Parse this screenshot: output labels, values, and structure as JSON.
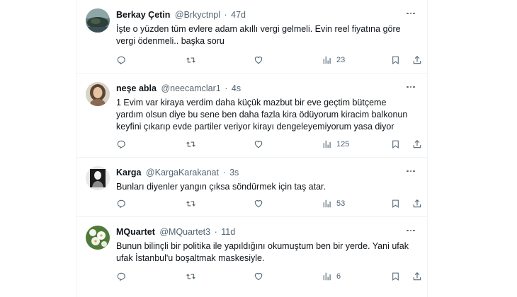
{
  "tweets": [
    {
      "display_name": "Berkay Çetin",
      "handle": "@Brkyctnpl",
      "separator": "·",
      "time": "47d",
      "lines": [
        "İşte o yüzden tüm evlere adam akıllı vergi gelmeli. Evin reel fiyatına göre",
        "vergi ödenmeli.. başka soru"
      ],
      "views": "23",
      "avatar_icon": "landscape-avatar-icon"
    },
    {
      "display_name": "neşe abla",
      "handle": "@neecamclar1",
      "separator": "·",
      "time": "4s",
      "lines": [
        "1 Evim var kiraya verdim daha küçük mazbut bir eve geçtim bütçeme",
        "yardım olsun diye bu sene ben daha fazla kira ödüyorum  kiracim balkonun",
        "keyfini çıkarıp evde partiler veriyor  kirayı dengeleyemiyorum yasa diyor"
      ],
      "views": "125",
      "avatar_icon": "woman-portrait-avatar-icon"
    },
    {
      "display_name": "Karga",
      "handle": "@KargaKarakanat",
      "separator": "·",
      "time": "3s",
      "lines": [
        "Bunları diyenler yangın çıksa söndürmek için taş atar."
      ],
      "views": "53",
      "avatar_icon": "monochrome-figure-avatar-icon"
    },
    {
      "display_name": "MQuartet",
      "handle": "@MQuartet3",
      "separator": "·",
      "time": "11d",
      "lines": [
        "Bunun bilinçli bir politika ile yapıldığını okumuştum ben bir yerde. Yani ufak",
        "ufak İstanbul'u boşaltmak maskesiyle."
      ],
      "views": "6",
      "avatar_icon": "flower-avatar-icon"
    }
  ],
  "action_icons": [
    "reply-icon",
    "retweet-icon",
    "like-icon",
    "views-icon",
    "bookmark-icon",
    "share-icon"
  ],
  "colors": {
    "text_primary": "#0f1419",
    "text_secondary": "#536471",
    "divider": "#eff3f4",
    "background": "#ffffff"
  }
}
